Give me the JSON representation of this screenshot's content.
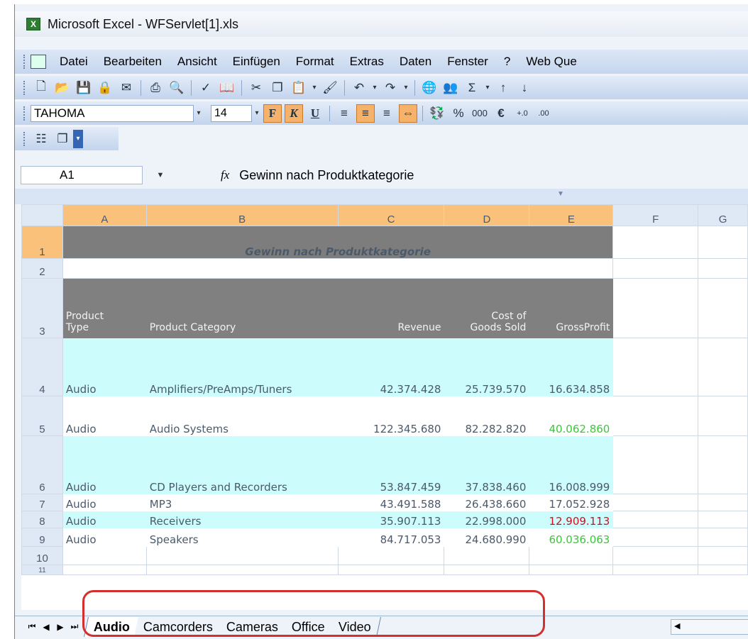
{
  "window": {
    "title": "Microsoft Excel - WFServlet[1].xls",
    "app_icon": "excel-icon"
  },
  "menu": {
    "items": [
      "Datei",
      "Bearbeiten",
      "Ansicht",
      "Einfügen",
      "Format",
      "Extras",
      "Daten",
      "Fenster",
      "?",
      "Web Que"
    ]
  },
  "format_toolbar": {
    "font_name": "TAHOMA",
    "font_size": "14",
    "bold": "F",
    "italic": "K",
    "underline": "U",
    "percent": "%",
    "thousands": "000",
    "euro": "€"
  },
  "formula_bar": {
    "cell_ref": "A1",
    "fx": "fx",
    "formula": "Gewinn nach Produktkategorie"
  },
  "columns": [
    "A",
    "B",
    "C",
    "D",
    "E",
    "F",
    "G"
  ],
  "sheet": {
    "title": "Gewinn nach Produktkategorie",
    "headers": {
      "product_type": [
        "Product",
        "Type"
      ],
      "product_category": "Product Category",
      "revenue": "Revenue",
      "cogs": [
        "Cost of",
        "Goods Sold"
      ],
      "gross_profit": "GrossProfit"
    },
    "rows": [
      {
        "n": "4",
        "type": "Audio",
        "category": "Amplifiers/PreAmps/Tuners",
        "revenue": "42.374.428",
        "cogs": "25.739.570",
        "profit": "16.634.858",
        "profit_color": "normal"
      },
      {
        "n": "5",
        "type": "Audio",
        "category": "Audio Systems",
        "revenue": "122.345.680",
        "cogs": "82.282.820",
        "profit": "40.062.860",
        "profit_color": "green"
      },
      {
        "n": "6",
        "type": "Audio",
        "category": "CD Players and Recorders",
        "revenue": "53.847.459",
        "cogs": "37.838.460",
        "profit": "16.008.999",
        "profit_color": "normal"
      },
      {
        "n": "7",
        "type": "Audio",
        "category": "MP3",
        "revenue": "43.491.588",
        "cogs": "26.438.660",
        "profit": "17.052.928",
        "profit_color": "normal"
      },
      {
        "n": "8",
        "type": "Audio",
        "category": "Receivers",
        "revenue": "35.907.113",
        "cogs": "22.998.000",
        "profit": "12.909.113",
        "profit_color": "red"
      },
      {
        "n": "9",
        "type": "Audio",
        "category": "Speakers",
        "revenue": "84.717.053",
        "cogs": "24.680.990",
        "profit": "60.036.063",
        "profit_color": "green"
      }
    ],
    "row_labels": [
      "1",
      "2",
      "3",
      "10",
      "11"
    ]
  },
  "colors": {
    "green": "#3ec43e",
    "red": "#d01020",
    "header_gray": "#808080",
    "band_cyan": "#ccfcfc",
    "highlight": "#d32f2f"
  },
  "tabs": {
    "items": [
      "Audio",
      "Camcorders",
      "Cameras",
      "Office",
      "Video"
    ],
    "active": "Audio"
  }
}
